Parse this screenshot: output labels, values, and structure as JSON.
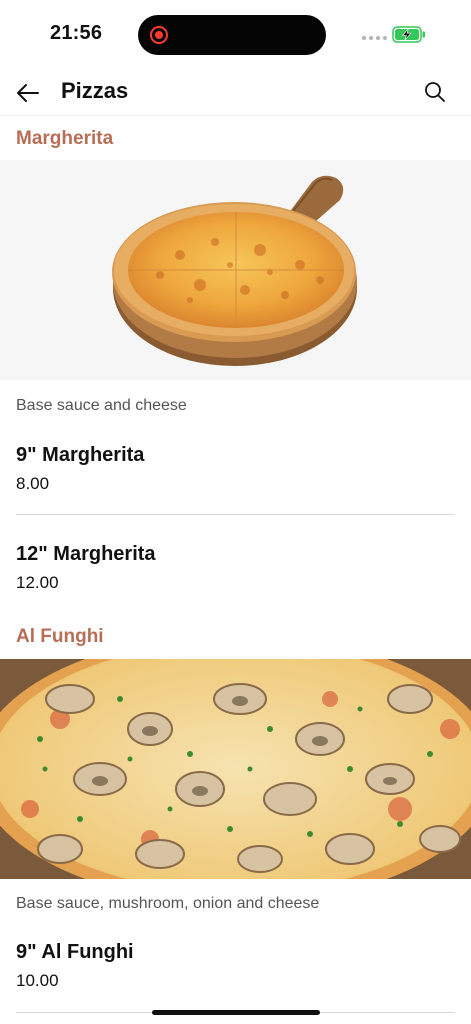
{
  "status": {
    "time": "21:56"
  },
  "header": {
    "title": "Pizzas"
  },
  "sections": [
    {
      "title": "Margherita",
      "description": "Base sauce and cheese",
      "items": [
        {
          "name": "9\" Margherita",
          "price": "8.00"
        },
        {
          "name": "12\" Margherita",
          "price": "12.00"
        }
      ]
    },
    {
      "title": "Al Funghi",
      "description": "Base sauce, mushroom, onion and cheese",
      "items": [
        {
          "name": "9\" Al Funghi",
          "price": "10.00"
        }
      ]
    }
  ],
  "colors": {
    "accent": "#b86e56",
    "battery": "#34c759",
    "recording": "#ff3b30"
  },
  "icons": [
    "back-arrow-icon",
    "search-icon",
    "recording-icon",
    "battery-charging-icon",
    "signal-dots-icon"
  ]
}
